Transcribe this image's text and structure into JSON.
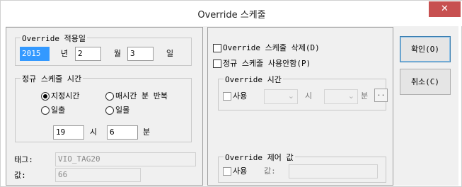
{
  "window": {
    "title": "Override 스케줄",
    "close_glyph": "✕"
  },
  "left": {
    "override_apply_date": {
      "label": "Override 적용일",
      "year": "2015",
      "year_unit": "년",
      "month": "2",
      "month_unit": "월",
      "day": "3",
      "day_unit": "일"
    },
    "regular_schedule_time": {
      "label": "정규 스케줄 시간",
      "options": {
        "fixed_time": "지정시간",
        "hourly_repeat": "매시간 분 반복",
        "sunrise": "일출",
        "sunset": "일몰"
      },
      "selected": "fixed_time",
      "hour": "19",
      "hour_unit": "시",
      "minute": "6",
      "minute_unit": "분"
    },
    "tag": {
      "label": "태그:",
      "value": "VIO_TAG20"
    },
    "value": {
      "label": "값:",
      "value": "66"
    }
  },
  "right": {
    "delete_override": {
      "label": "Override 스케줄 삭제(D)",
      "checked": false
    },
    "disable_regular": {
      "label": "정규 스케줄 사용안함(P)",
      "checked": false
    },
    "override_time": {
      "label": "Override 시간",
      "use_label": "사용",
      "hour_unit": "시",
      "minute_unit": "분",
      "browse_label": ".."
    },
    "override_control_value": {
      "label": "Override 제어 값",
      "use_label": "사용",
      "value_label": "값:"
    }
  },
  "buttons": {
    "ok": "확인(O)",
    "cancel": "취소(C)"
  }
}
